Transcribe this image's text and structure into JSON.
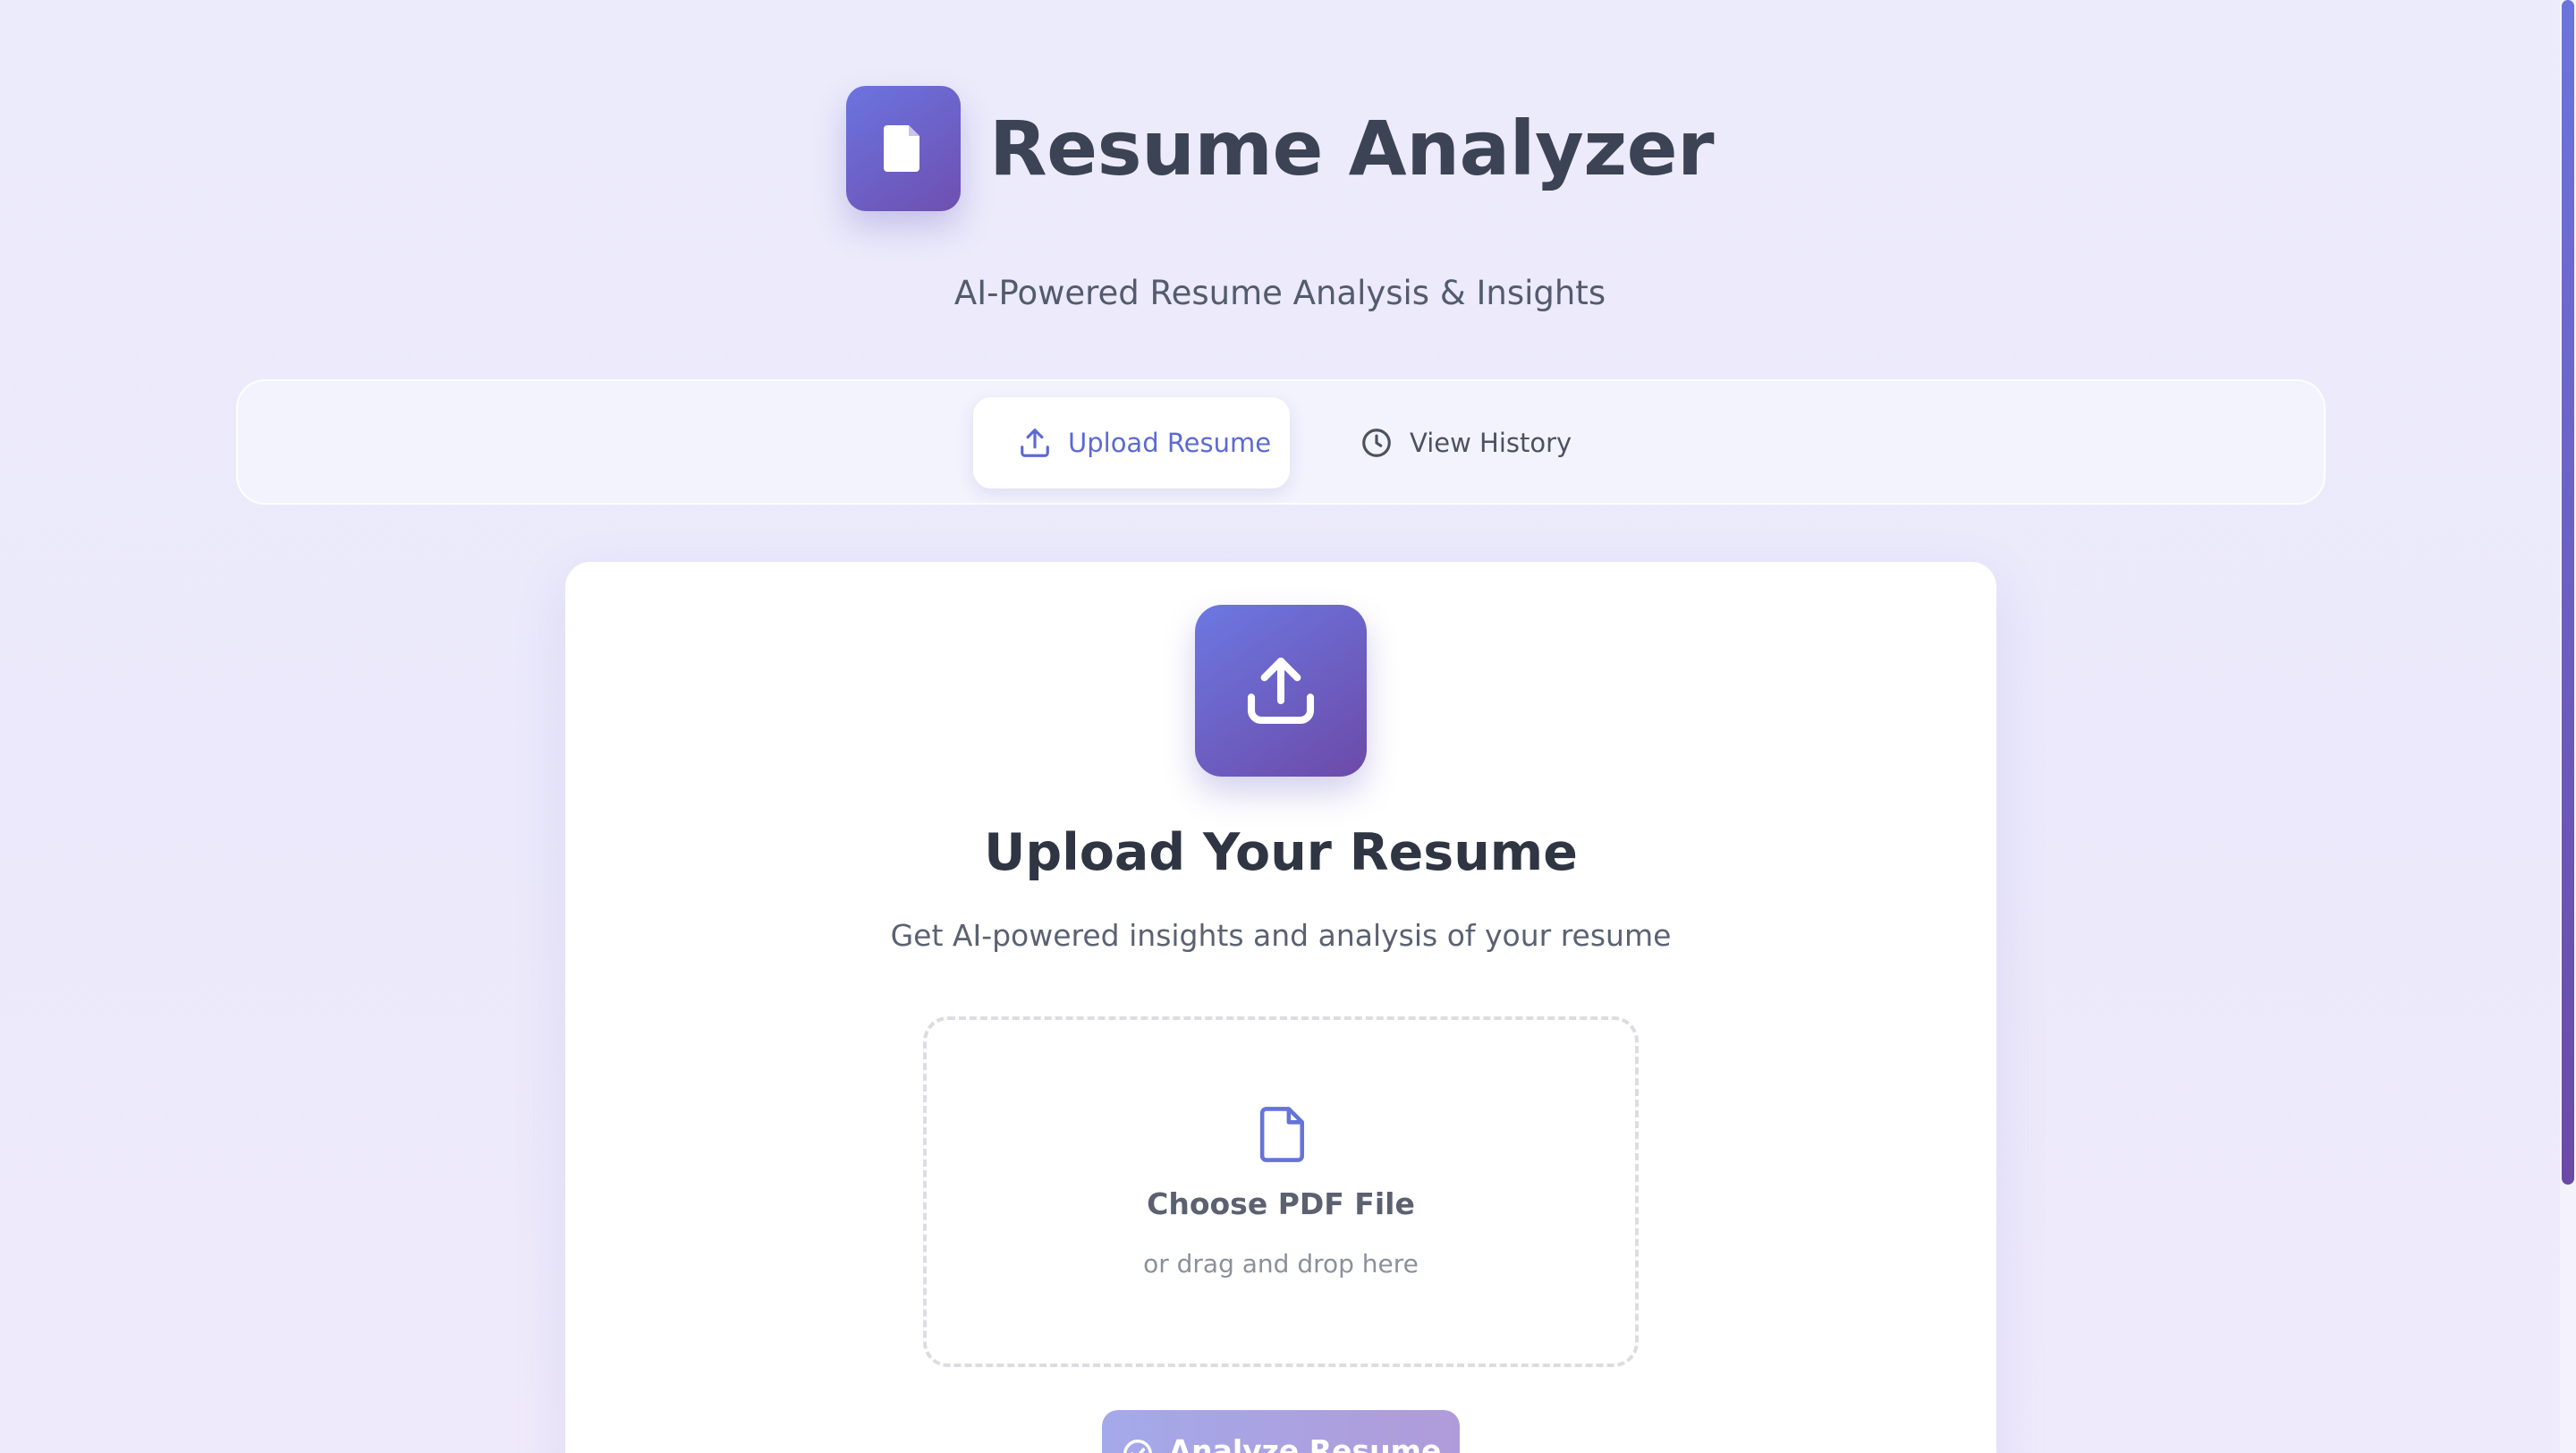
{
  "header": {
    "title": "Resume Analyzer",
    "subtitle": "AI-Powered Resume Analysis & Insights",
    "logo_icon": "document-icon"
  },
  "tabs": [
    {
      "label": "Upload Resume",
      "icon": "upload-icon",
      "active": true
    },
    {
      "label": "View History",
      "icon": "clock-icon",
      "active": false
    }
  ],
  "upload_card": {
    "icon": "upload-icon",
    "title": "Upload Your Resume",
    "description": "Get AI-powered insights and analysis of your resume",
    "dropzone": {
      "icon": "file-icon",
      "title": "Choose PDF File",
      "subtitle": "or drag and drop here"
    },
    "analyze_button": {
      "label": "Analyze Resume",
      "icon": "check-circle-icon"
    }
  },
  "colors": {
    "accent": "#5b6ad6",
    "gradient_start": "#6c78e2",
    "gradient_end": "#6c4aa8",
    "background": "#ecebfb"
  }
}
